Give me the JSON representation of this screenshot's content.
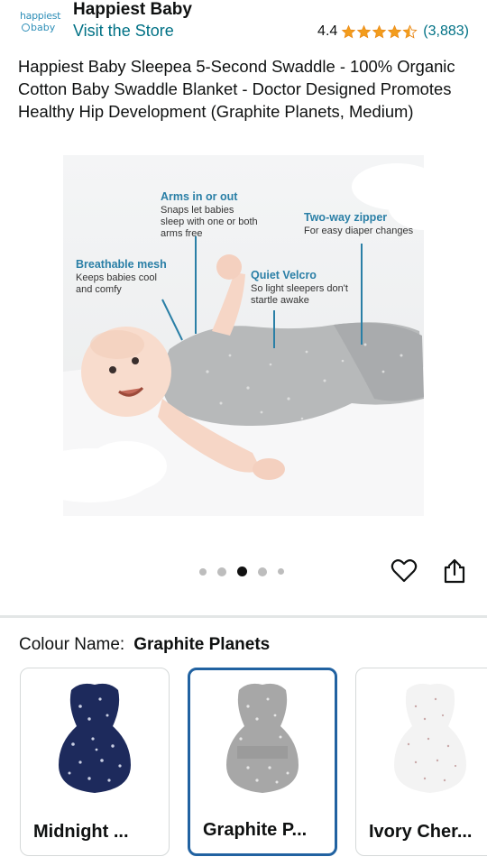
{
  "header": {
    "brand_logo_line1": "happiest",
    "brand_logo_line2": "baby",
    "brand_name": "Happiest Baby",
    "visit_store": "Visit the Store",
    "rating_value": "4.4",
    "rating_stars": 4.4,
    "rating_count": "(3,883)"
  },
  "product": {
    "title": "Happiest Baby Sleepea 5-Second Swaddle - 100% Organic Cotton Baby Swaddle Blanket - Doctor Designed Promotes Healthy Hip Development (Graphite Planets, Medium)"
  },
  "image_annotations": {
    "arms": {
      "heading": "Arms in or out",
      "body": "Snaps let babies sleep with one or both arms free"
    },
    "zipper": {
      "heading": "Two-way zipper",
      "body": "For easy diaper changes"
    },
    "mesh": {
      "heading": "Breathable mesh",
      "body": "Keeps babies cool and comfy"
    },
    "velcro": {
      "heading": "Quiet Velcro",
      "body": "So light sleepers don't startle awake"
    }
  },
  "carousel": {
    "total": 5,
    "active_index": 2
  },
  "actions": {
    "wishlist_icon": "heart-icon",
    "share_icon": "share-icon"
  },
  "colour": {
    "label": "Colour Name:",
    "selected": "Graphite Planets",
    "options": [
      {
        "label": "Midnight ...",
        "color": "#1d2a5c"
      },
      {
        "label": "Graphite P...",
        "color": "#a7a7a7"
      },
      {
        "label": "Ivory Cher...",
        "color": "#f3f3f3"
      }
    ]
  }
}
